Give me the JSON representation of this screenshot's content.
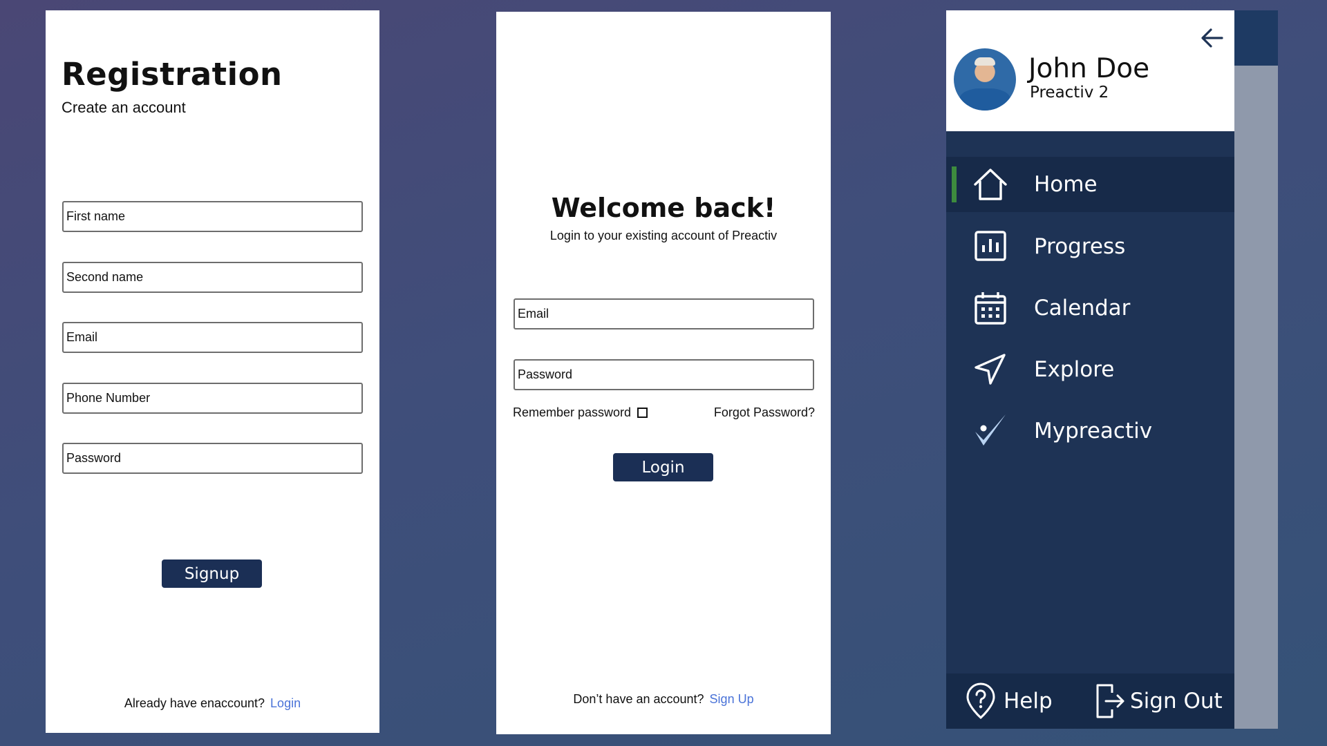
{
  "registration": {
    "title": "Registration",
    "subtitle": "Create an account",
    "fields": [
      {
        "placeholder": "First name"
      },
      {
        "placeholder": "Second name"
      },
      {
        "placeholder": "Email"
      },
      {
        "placeholder": "Phone Number"
      },
      {
        "placeholder": "Password"
      }
    ],
    "signup_label": "Signup",
    "footer_text": "Already have enaccount?",
    "footer_link": "Login"
  },
  "login": {
    "title": "Welcome back!",
    "subtitle": "Login to your existing account of Preactiv",
    "email_placeholder": "Email",
    "password_placeholder": "Password",
    "remember_label": "Remember password",
    "forgot_label": "Forgot Password?",
    "login_label": "Login",
    "footer_text": "Don’t have an account?",
    "footer_link": "Sign Up"
  },
  "drawer": {
    "user": {
      "name": "John Doe",
      "plan": "Preactiv 2"
    },
    "menu": [
      {
        "label": "Home",
        "icon": "home-icon",
        "active": true
      },
      {
        "label": "Progress",
        "icon": "bar-chart-icon",
        "active": false
      },
      {
        "label": "Calendar",
        "icon": "calendar-icon",
        "active": false
      },
      {
        "label": "Explore",
        "icon": "navigation-arrow-icon",
        "active": false
      },
      {
        "label": "Mypreactiv",
        "icon": "checkmark-icon",
        "active": false
      }
    ],
    "footer": {
      "help_label": "Help",
      "signout_label": "Sign Out"
    }
  },
  "colors": {
    "primary_button": "#1b2f55",
    "drawer_background": "#1e3355",
    "active_indicator": "#3d8b3e",
    "link": "#4a73d8"
  }
}
